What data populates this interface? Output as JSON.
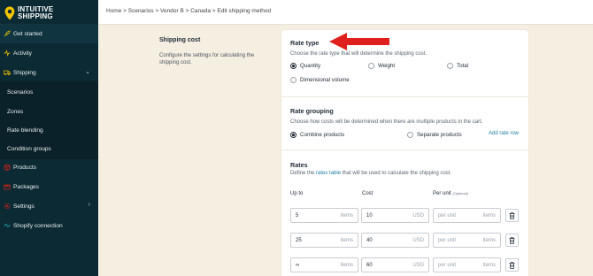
{
  "app": {
    "logo_line1": "INTUITIVE",
    "logo_line2": "SHIPPING"
  },
  "breadcrumb": "Home > Scenarios > Vendor B > Canada > Edit shipping method",
  "sidebar": {
    "items": [
      {
        "label": "Get started",
        "icon": "rocket-icon"
      },
      {
        "label": "Activity",
        "icon": "activity-icon"
      },
      {
        "label": "Shipping",
        "icon": "truck-icon",
        "expanded": true
      },
      {
        "label": "Scenarios"
      },
      {
        "label": "Zones"
      },
      {
        "label": "Rate blending"
      },
      {
        "label": "Condition groups"
      },
      {
        "label": "Products",
        "icon": "box-icon"
      },
      {
        "label": "Packages",
        "icon": "package-icon"
      },
      {
        "label": "Settings",
        "icon": "gear-icon"
      },
      {
        "label": "Shopify connection",
        "icon": "link-icon"
      }
    ]
  },
  "shipping_cost": {
    "title": "Shipping cost",
    "description": "Configure the settings for calculating the shipping cost."
  },
  "rate_type": {
    "title": "Rate type",
    "description": "Choose the rate type that will determine the shipping cost.",
    "options": [
      "Quantity",
      "Weight",
      "Total",
      "Dimensional volume"
    ],
    "selected": "Quantity"
  },
  "rate_grouping": {
    "title": "Rate grouping",
    "description": "Choose how costs will be determined when there are multiple products in the cart.",
    "options": [
      "Combine products",
      "Separate products"
    ],
    "selected": "Combine products"
  },
  "rates": {
    "title": "Rates",
    "description_pre": "Define the ",
    "description_link": "rates table",
    "description_post": " that will be used to calculate the shipping cost.",
    "add_row": "Add rate row",
    "columns": {
      "up_to": "Up to",
      "cost": "Cost",
      "per_unit": "Per unit",
      "optional": "(Optional)"
    },
    "unit_label": "items",
    "currency": "USD",
    "per_unit_placeholder": "per unit",
    "rows": [
      {
        "up_to": "5",
        "cost": "10"
      },
      {
        "up_to": "25",
        "cost": "40"
      },
      {
        "up_to": "∞",
        "cost": "60"
      }
    ]
  },
  "colors": {
    "sidebar": "#0c2a33",
    "accent": "#1b7fa3",
    "background": "#f5efe2",
    "arrow": "#e0201c",
    "logo_yellow": "#f5c400"
  }
}
